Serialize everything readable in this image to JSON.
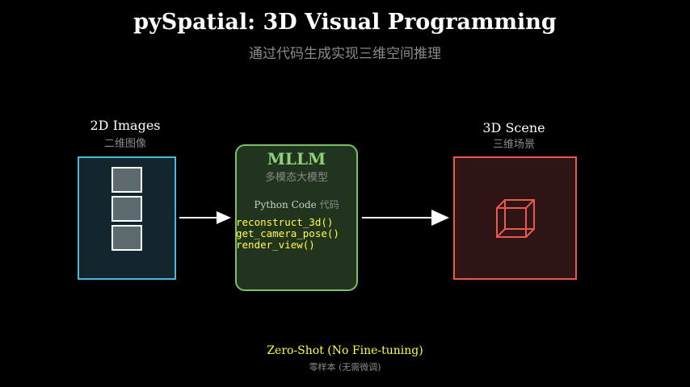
{
  "header": {
    "title": "pySpatial: 3D Visual Programming",
    "subtitle": "通过代码生成实现三维空间推理"
  },
  "input_node": {
    "label": "2D Images",
    "sublabel": "二维图像",
    "image_count": 3,
    "color": "#4cb8d8"
  },
  "mllm_node": {
    "title": "MLLM",
    "subtitle": "多模态大模型",
    "code_label": "Python Code",
    "code_label_zh": "代码",
    "code_lines": [
      "reconstruct_3d()",
      "get_camera_pose()",
      "render_view()"
    ],
    "color": "#7cc06a",
    "code_color": "#ffff40"
  },
  "output_node": {
    "label": "3D Scene",
    "sublabel": "三维场景",
    "icon": "cube-icon",
    "color": "#e85a4f"
  },
  "footer": {
    "main": "Zero-Shot (No Fine-tuning)",
    "sub": "零样本 (无需微调)",
    "color": "#ffff33"
  },
  "arrows": [
    "arrow-right-icon",
    "arrow-right-icon"
  ]
}
